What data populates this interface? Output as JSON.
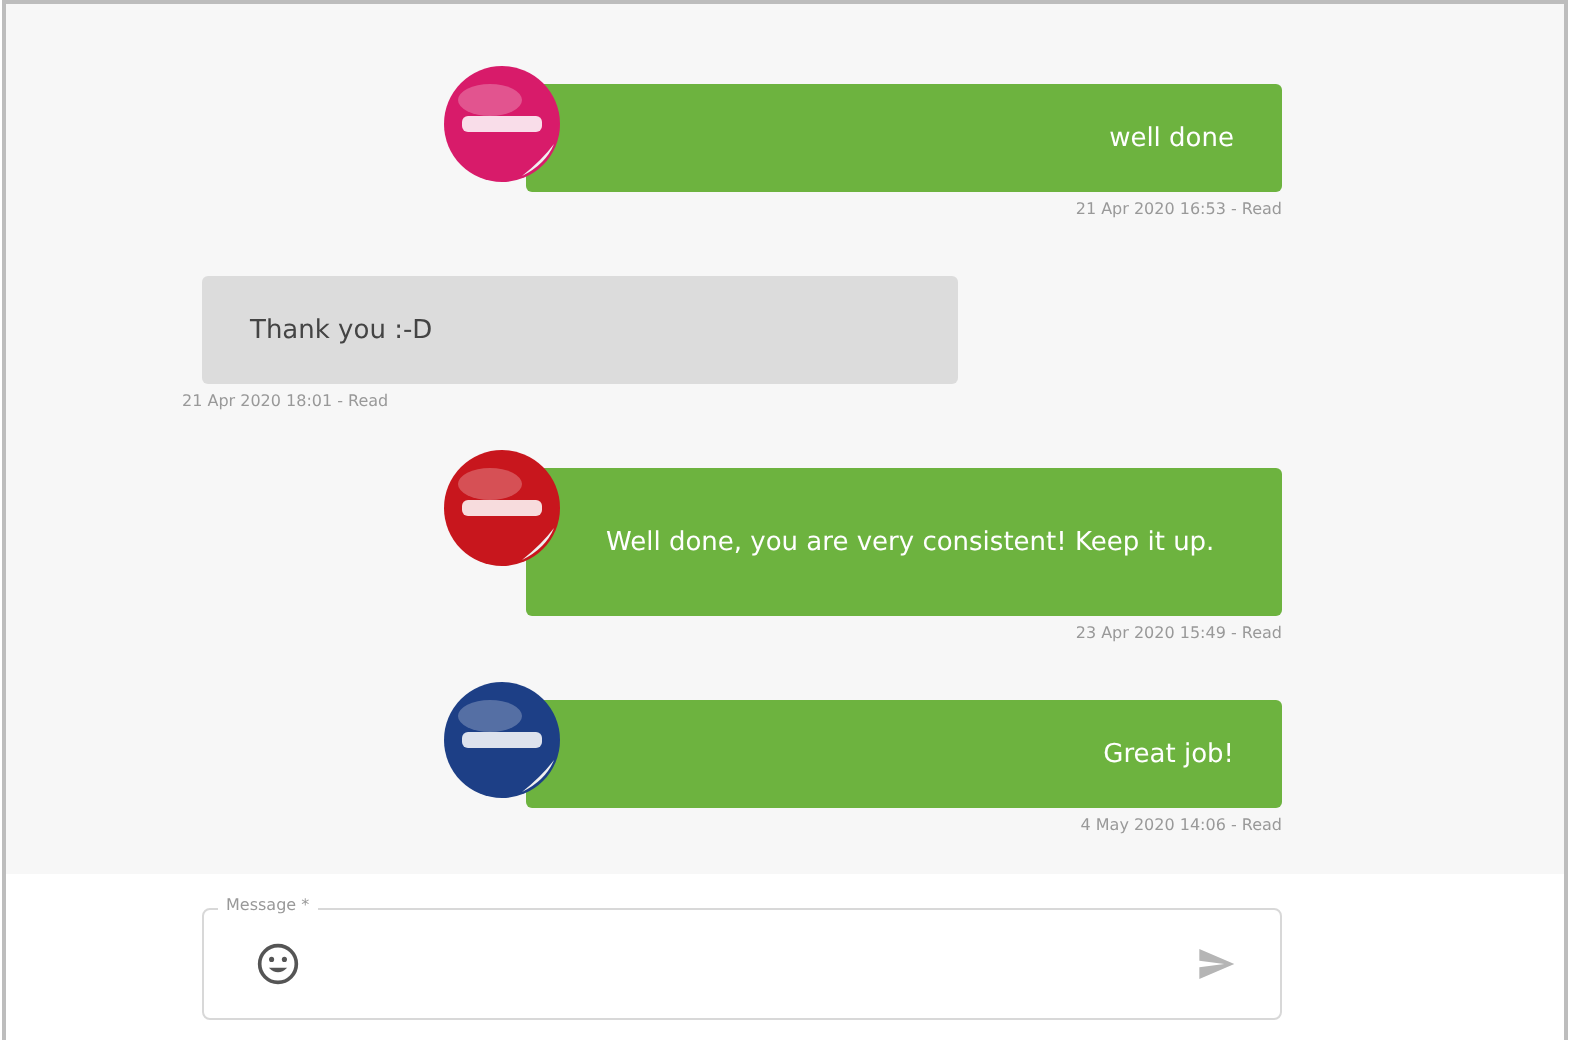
{
  "messages": [
    {
      "kind": "sent",
      "color": "#d81b6a",
      "text": "well done",
      "meta": "21 Apr 2020 16:53 - Read"
    },
    {
      "kind": "received",
      "text": "Thank you :-D",
      "meta": "21 Apr 2020 18:01 - Read"
    },
    {
      "kind": "sent",
      "color": "#c8161d",
      "text": "Well done, you are very consistent! Keep it up.",
      "meta": "23 Apr 2020 15:49 - Read"
    },
    {
      "kind": "sent",
      "color": "#1d3f86",
      "text": "Great job!",
      "meta": "4 May 2020 14:06 - Read"
    }
  ],
  "composer": {
    "label": "Message *"
  }
}
